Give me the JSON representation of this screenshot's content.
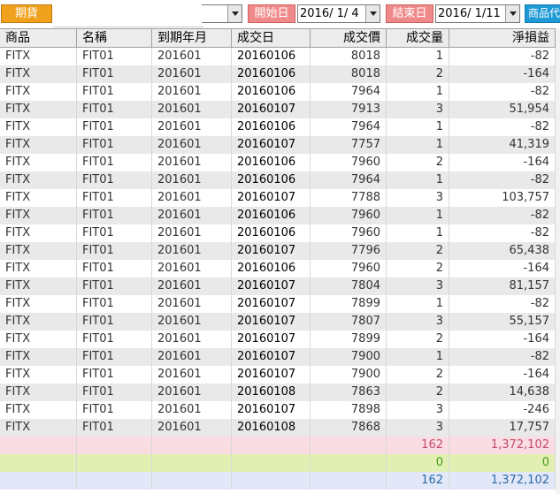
{
  "toolbar": {
    "futures_label": "期貨",
    "start_label": "開始日",
    "start_date": "2016/ 1/ 4",
    "end_label": "結束日",
    "end_date": "2016/ 1/11",
    "product_label": "商品代"
  },
  "columns": [
    "商品",
    "名稱",
    "到期年月",
    "成交日",
    "成交價",
    "成交量",
    "淨損益"
  ],
  "rows": [
    [
      "FITX",
      "FIT01",
      "201601",
      "20160106",
      "8018",
      "1",
      "-82"
    ],
    [
      "FITX",
      "FIT01",
      "201601",
      "20160106",
      "8018",
      "2",
      "-164"
    ],
    [
      "FITX",
      "FIT01",
      "201601",
      "20160106",
      "7964",
      "1",
      "-82"
    ],
    [
      "FITX",
      "FIT01",
      "201601",
      "20160107",
      "7913",
      "3",
      "51,954"
    ],
    [
      "FITX",
      "FIT01",
      "201601",
      "20160106",
      "7964",
      "1",
      "-82"
    ],
    [
      "FITX",
      "FIT01",
      "201601",
      "20160107",
      "7757",
      "1",
      "41,319"
    ],
    [
      "FITX",
      "FIT01",
      "201601",
      "20160106",
      "7960",
      "2",
      "-164"
    ],
    [
      "FITX",
      "FIT01",
      "201601",
      "20160106",
      "7964",
      "1",
      "-82"
    ],
    [
      "FITX",
      "FIT01",
      "201601",
      "20160107",
      "7788",
      "3",
      "103,757"
    ],
    [
      "FITX",
      "FIT01",
      "201601",
      "20160106",
      "7960",
      "1",
      "-82"
    ],
    [
      "FITX",
      "FIT01",
      "201601",
      "20160106",
      "7960",
      "1",
      "-82"
    ],
    [
      "FITX",
      "FIT01",
      "201601",
      "20160107",
      "7796",
      "2",
      "65,438"
    ],
    [
      "FITX",
      "FIT01",
      "201601",
      "20160106",
      "7960",
      "2",
      "-164"
    ],
    [
      "FITX",
      "FIT01",
      "201601",
      "20160107",
      "7804",
      "3",
      "81,157"
    ],
    [
      "FITX",
      "FIT01",
      "201601",
      "20160107",
      "7899",
      "1",
      "-82"
    ],
    [
      "FITX",
      "FIT01",
      "201601",
      "20160107",
      "7807",
      "3",
      "55,157"
    ],
    [
      "FITX",
      "FIT01",
      "201601",
      "20160107",
      "7899",
      "2",
      "-164"
    ],
    [
      "FITX",
      "FIT01",
      "201601",
      "20160107",
      "7900",
      "1",
      "-82"
    ],
    [
      "FITX",
      "FIT01",
      "201601",
      "20160107",
      "7900",
      "2",
      "-164"
    ],
    [
      "FITX",
      "FIT01",
      "201601",
      "20160108",
      "7863",
      "2",
      "14,638"
    ],
    [
      "FITX",
      "FIT01",
      "201601",
      "20160107",
      "7898",
      "3",
      "-246"
    ],
    [
      "FITX",
      "FIT01",
      "201601",
      "20160108",
      "7868",
      "3",
      "17,757"
    ]
  ],
  "summary": [
    {
      "volume": "162",
      "pnl": "1,372,102",
      "style": "sum-pink"
    },
    {
      "volume": "0",
      "pnl": "0",
      "style": "sum-green"
    },
    {
      "volume": "162",
      "pnl": "1,372,102",
      "style": "sum-blue"
    }
  ]
}
